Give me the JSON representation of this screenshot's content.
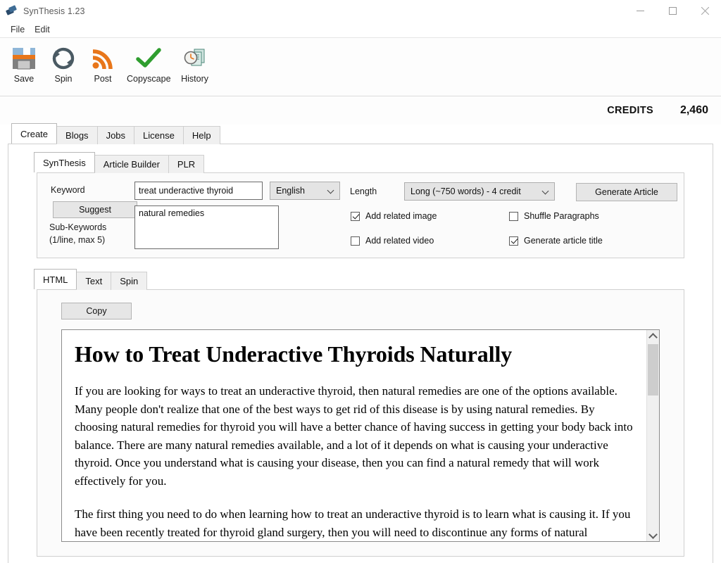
{
  "window": {
    "title": "SynThesis 1.23",
    "app_icon": "app-books-icon",
    "minimize": "─",
    "maximize": "□",
    "close": "✕"
  },
  "menubar": {
    "items": [
      {
        "label": "File"
      },
      {
        "label": "Edit"
      }
    ]
  },
  "toolbar": {
    "buttons": [
      {
        "label": "Save",
        "icon": "floppy-disk-icon"
      },
      {
        "label": "Spin",
        "icon": "refresh-cycle-icon"
      },
      {
        "label": "Post",
        "icon": "rss-feed-icon"
      },
      {
        "label": "Copyscape",
        "icon": "green-check-icon"
      },
      {
        "label": "History",
        "icon": "clock-documents-icon"
      }
    ]
  },
  "credits": {
    "label": "CREDITS",
    "value": "2,460"
  },
  "main_tabs": {
    "items": [
      {
        "label": "Create",
        "active": true
      },
      {
        "label": "Blogs",
        "active": false
      },
      {
        "label": "Jobs",
        "active": false
      },
      {
        "label": "License",
        "active": false
      },
      {
        "label": "Help",
        "active": false
      }
    ]
  },
  "sub_tabs": {
    "items": [
      {
        "label": "SynThesis",
        "active": true
      },
      {
        "label": "Article Builder",
        "active": false
      },
      {
        "label": "PLR",
        "active": false
      }
    ]
  },
  "form": {
    "keyword_label": "Keyword",
    "keyword_value": "treat underactive thyroid",
    "keyword_placeholder": "",
    "suggest_label": "Suggest",
    "subkeywords_label_line1": "Sub-Keywords",
    "subkeywords_label_line2": "(1/line, max 5)",
    "subkeywords_value": "natural remedies",
    "subkeywords_placeholder": "",
    "language_value": "English",
    "language_options": [
      "English"
    ],
    "length_label": "Length",
    "length_value": "Long (~750 words) - 4 credit",
    "length_options": [
      "Long (~750 words) - 4 credit"
    ],
    "generate_label": "Generate Article",
    "checkboxes": [
      {
        "label": "Add related image",
        "checked": true
      },
      {
        "label": "Add related video",
        "checked": false
      },
      {
        "label": "Shuffle Paragraphs",
        "checked": false
      },
      {
        "label": "Generate article title",
        "checked": true
      }
    ]
  },
  "output_tabs": {
    "items": [
      {
        "label": "HTML",
        "active": true
      },
      {
        "label": "Text",
        "active": false
      },
      {
        "label": "Spin",
        "active": false
      }
    ]
  },
  "output": {
    "copy_label": "Copy",
    "article": {
      "title": "How to Treat Underactive Thyroids Naturally",
      "paragraphs": [
        "If you are looking for ways to treat an underactive thyroid, then natural remedies are one of the options available. Many people don't realize that one of the best ways to get rid of this disease is by using natural remedies. By choosing natural remedies for thyroid you will have a better chance of having success in getting your body back into balance. There are many natural remedies available, and a lot of it depends on what is causing your underactive thyroid. Once you understand what is causing your disease, then you can find a natural remedy that will work effectively for you.",
        "The first thing you need to do when learning how to treat an underactive thyroid is to learn what is causing it. If you have been recently treated for thyroid gland surgery, then you will need to discontinue any forms of natural remedies until you heal from your surgery. Certain medications such as lithium and"
      ]
    },
    "scrollbar": {
      "up_arrow": "scroll-up-arrow",
      "down_arrow": "scroll-down-arrow"
    }
  },
  "colors": {
    "accent_orange": "#e8761a",
    "accent_green": "#2f9e2f",
    "window_bg": "#ffffff",
    "panel_bg": "#fbfbfb"
  }
}
